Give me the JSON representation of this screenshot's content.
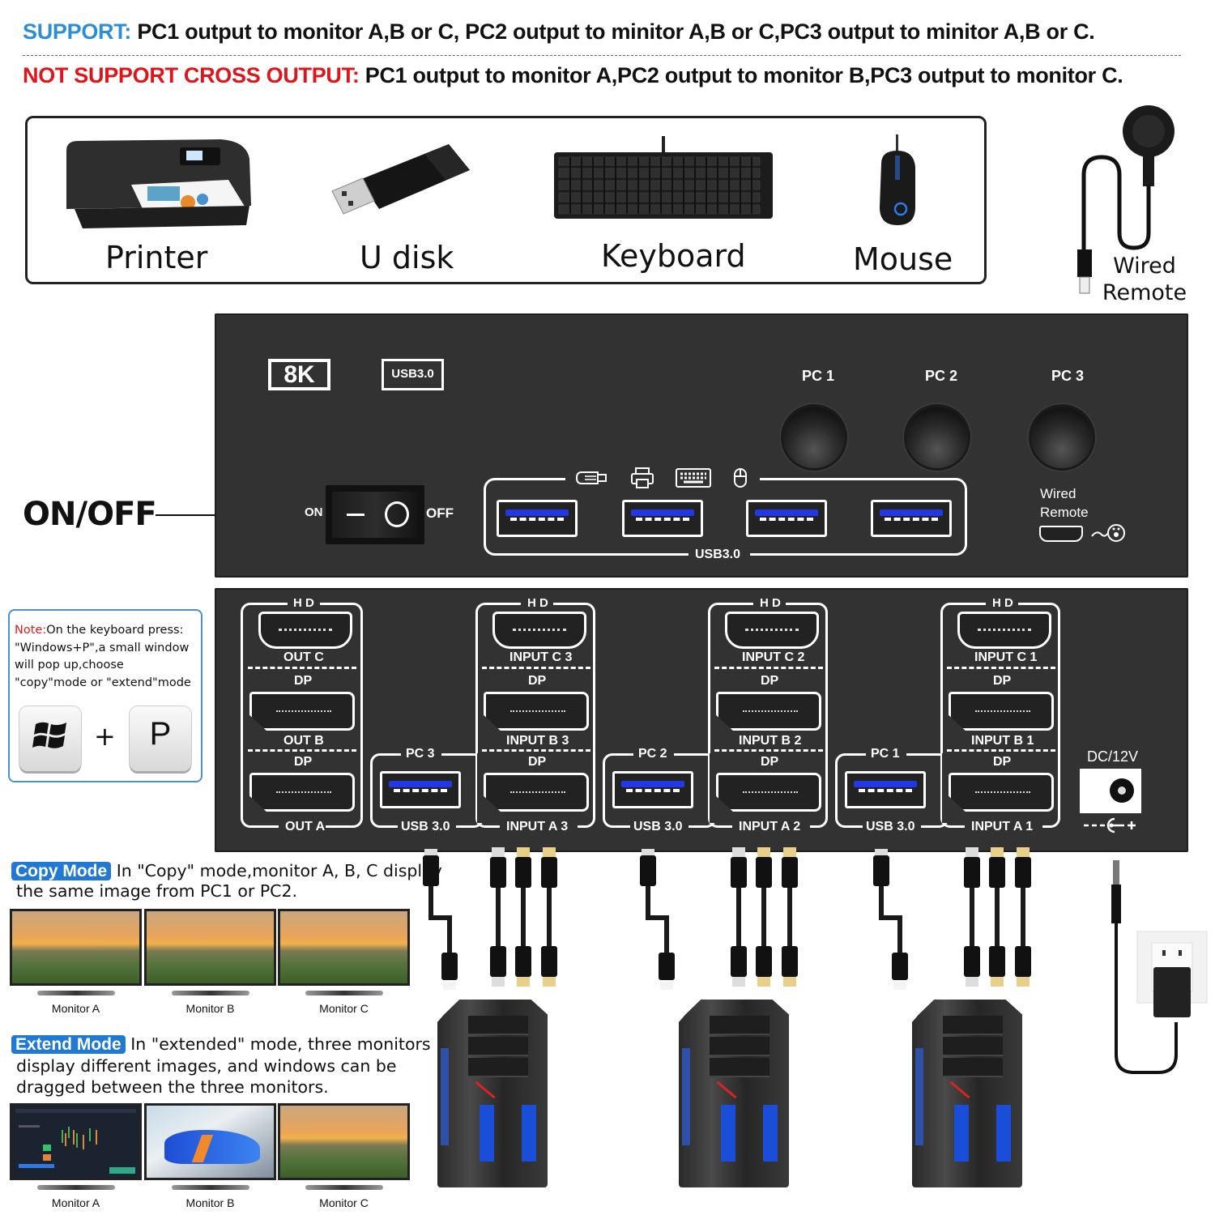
{
  "header": {
    "support_tag": "SUPPORT:",
    "support_text": " PC1 output to monitor A,B or C, PC2 output to minitor A,B or C,PC3 output to minitor A,B or C.",
    "not_support_tag": "NOT SUPPORT CROSS OUTPUT:",
    "not_support_text": " PC1 output to monitor A,PC2 output to monitor B,PC3 output to monitor C.",
    "colors": {
      "support": "#2d8ed8",
      "not_support": "#e0141b"
    }
  },
  "peripherals": [
    {
      "label": "Printer",
      "icon": "printer-icon"
    },
    {
      "label": "U disk",
      "icon": "usb-drive-icon"
    },
    {
      "label": "Keyboard",
      "icon": "keyboard-icon"
    },
    {
      "label": "Mouse",
      "icon": "mouse-icon"
    }
  ],
  "wired_remote": {
    "line1": "Wired",
    "line2": "Remote"
  },
  "power_callout": "ON/OFF",
  "front_panel": {
    "badge_8k": "8K",
    "badge_usb": "USB3.0",
    "switch_on": "ON",
    "switch_off": "OFF",
    "pc_buttons": [
      "PC 1",
      "PC 2",
      "PC 3"
    ],
    "usb_group_label": "USB3.0",
    "wired_remote_port": {
      "line1": "Wired",
      "line2": "Remote"
    }
  },
  "rear_panel": {
    "outputs": {
      "hd": "H D",
      "out_c": "OUT C",
      "dp1": "DP",
      "out_b": "OUT B",
      "dp2": "DP",
      "out_a": "OUT A"
    },
    "pc_groups": [
      {
        "pc": "PC 3",
        "usb": "USB 3.0",
        "hd": "H D",
        "c": "INPUT C 3",
        "dp1": "DP",
        "b": "INPUT B 3",
        "dp2": "DP",
        "a": "INPUT A 3"
      },
      {
        "pc": "PC 2",
        "usb": "USB 3.0",
        "hd": "H D",
        "c": "INPUT C 2",
        "dp1": "DP",
        "b": "INPUT B 2",
        "dp2": "DP",
        "a": "INPUT A 2"
      },
      {
        "pc": "PC 1",
        "usb": "USB 3.0",
        "hd": "H D",
        "c": "INPUT C 1",
        "dp1": "DP",
        "b": "INPUT B 1",
        "dp2": "DP",
        "a": "INPUT A 1"
      }
    ],
    "dc_label": "DC/12V",
    "polarity": "- -C- +"
  },
  "note": {
    "prefix": "Note:",
    "text": "On the keyboard press: \"Windows+P\",a small window will pop up,choose \"copy\"mode or \"extend\"mode",
    "key_plus": "+",
    "key_p": "P"
  },
  "copy_mode": {
    "tag": "Copy Mode",
    "line1": " In \"Copy\" mode,monitor A, B, C display",
    "line2": "the same image from PC1 or PC2.",
    "monitors": [
      "Monitor A",
      "Monitor B",
      "Monitor C"
    ]
  },
  "extend_mode": {
    "tag": "Extend Mode",
    "line1": " In \"extended\" mode, three monitors",
    "line2": "display different images, and windows can be",
    "line3": "dragged between the three monitors.",
    "monitors": [
      "Monitor A",
      "Monitor B",
      "Monitor C"
    ]
  }
}
